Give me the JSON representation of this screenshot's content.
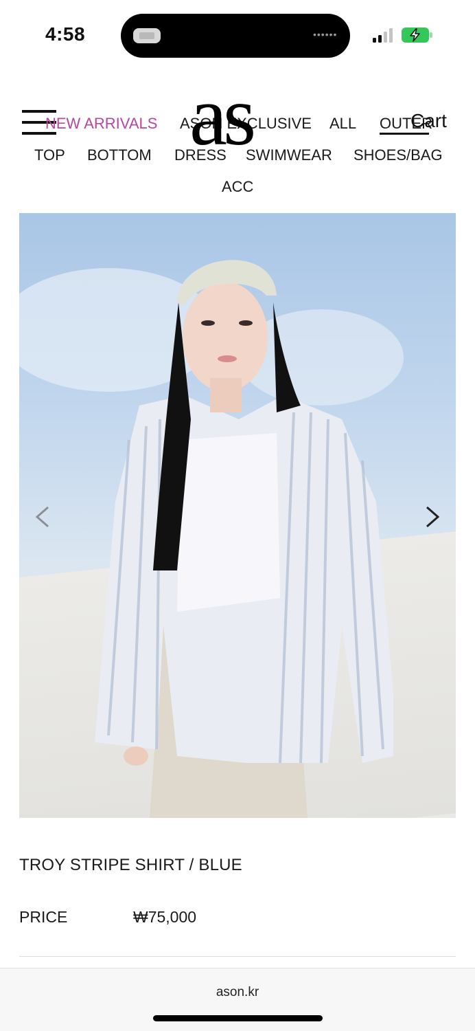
{
  "status_bar": {
    "time": "4:58",
    "island_dots": "••••••",
    "battery_color": "#34c759"
  },
  "header": {
    "logo": "as",
    "cart_label": "Cart",
    "nav": {
      "new_arrivals": "NEW ARRIVALS",
      "ason_exclusive": "ASON EXCLUSIVE",
      "all": "ALL",
      "outer": "OUTER",
      "top": "TOP",
      "bottom": "BOTTOM",
      "dress": "DRESS",
      "swimwear": "SWIMWEAR",
      "shoes_bag": "SHOES/BAG",
      "acc": "ACC"
    },
    "accent_color": "#b5479e"
  },
  "product": {
    "title": "TROY STRIPE SHIRT / BLUE",
    "price_label": "PRICE",
    "price_value": "₩75,000"
  },
  "browser": {
    "url": "ason.kr"
  },
  "icons": {
    "menu": "hamburger-icon",
    "prev": "chevron-left-icon",
    "next": "chevron-right-icon"
  }
}
